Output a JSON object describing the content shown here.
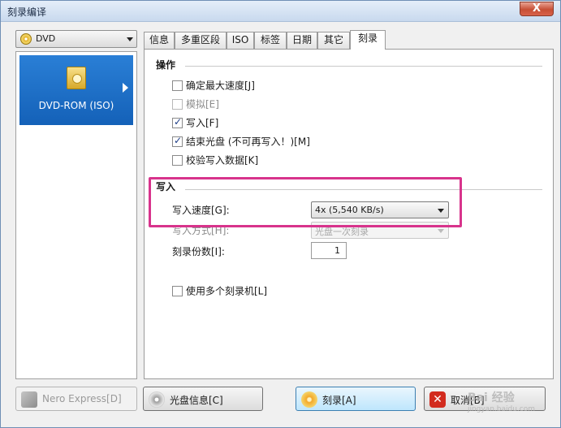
{
  "window": {
    "title": "刻录编译",
    "close": "X"
  },
  "device_combo": {
    "value": "DVD"
  },
  "left_panel": {
    "item_label": "DVD-ROM (ISO)"
  },
  "tabs": [
    {
      "label": "信息"
    },
    {
      "label": "多重区段"
    },
    {
      "label": "ISO"
    },
    {
      "label": "标签"
    },
    {
      "label": "日期"
    },
    {
      "label": "其它"
    },
    {
      "label": "刻录"
    }
  ],
  "operations": {
    "heading": "操作",
    "determine_max_speed": "确定最大速度[J]",
    "simulate": "模拟[E]",
    "write": "写入[F]",
    "finalize_disc": "结束光盘 (不可再写入！)[M]",
    "verify_data": "校验写入数据[K]"
  },
  "write_section": {
    "heading": "写入",
    "speed_label": "写入速度[G]:",
    "speed_value": "4x (5,540 KB/s)",
    "method_label": "写入方式[H]:",
    "method_value": "光盘一次刻录",
    "copies_label": "刻录份数[I]:",
    "copies_value": "1",
    "multi_recorder": "使用多个刻录机[L]"
  },
  "buttons": {
    "nero_express": "Nero Express[D]",
    "disc_info": "光盘信息[C]",
    "burn": "刻录[A]",
    "cancel": "取消[B]"
  },
  "watermark": {
    "brand": "Bai 经验",
    "url": "jingyan.baidu.com"
  },
  "colors": {
    "highlight": "#d8338c",
    "selection": "#1f6fc8"
  }
}
